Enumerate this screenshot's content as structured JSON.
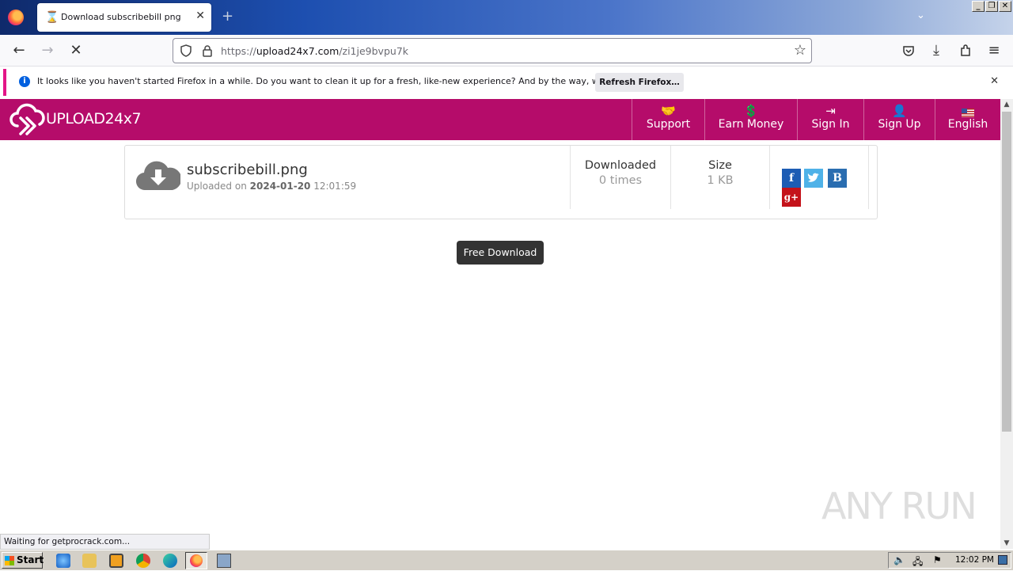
{
  "browser": {
    "tab_title": "Download subscribebill png",
    "url_prefix": "https://",
    "url_domain": "upload24x7.com",
    "url_path": "/zi1je9bvpu7k",
    "status_text": "Waiting for getprocrack.com..."
  },
  "notification": {
    "message": "It looks like you haven't started Firefox in a while. Do you want to clean it up for a fresh, like-new experience? And by the way, welcome back!",
    "button_label": "Refresh Firefox…"
  },
  "site": {
    "logo_text": "UPLOAD24x7",
    "menu": [
      {
        "label": "Support",
        "icon": "handshake-icon"
      },
      {
        "label": "Earn Money",
        "icon": "hand-money-icon"
      },
      {
        "label": "Sign In",
        "icon": "sign-in-icon"
      },
      {
        "label": "Sign Up",
        "icon": "user-plus-icon"
      },
      {
        "label": "English",
        "icon": "us-flag-icon"
      }
    ]
  },
  "file": {
    "name": "subscribebill.png",
    "uploaded_prefix": "Uploaded on",
    "uploaded_date": "2024-01-20",
    "uploaded_time": "12:01:59",
    "downloaded_label": "Downloaded",
    "downloaded_value": "0 times",
    "size_label": "Size",
    "size_value": "1 KB"
  },
  "share": {
    "facebook": "f",
    "vk": "B",
    "google": "g+"
  },
  "download_button": "Free Download",
  "watermark": "ANY RUN",
  "taskbar": {
    "start_label": "Start",
    "clock": "12:02 PM"
  }
}
